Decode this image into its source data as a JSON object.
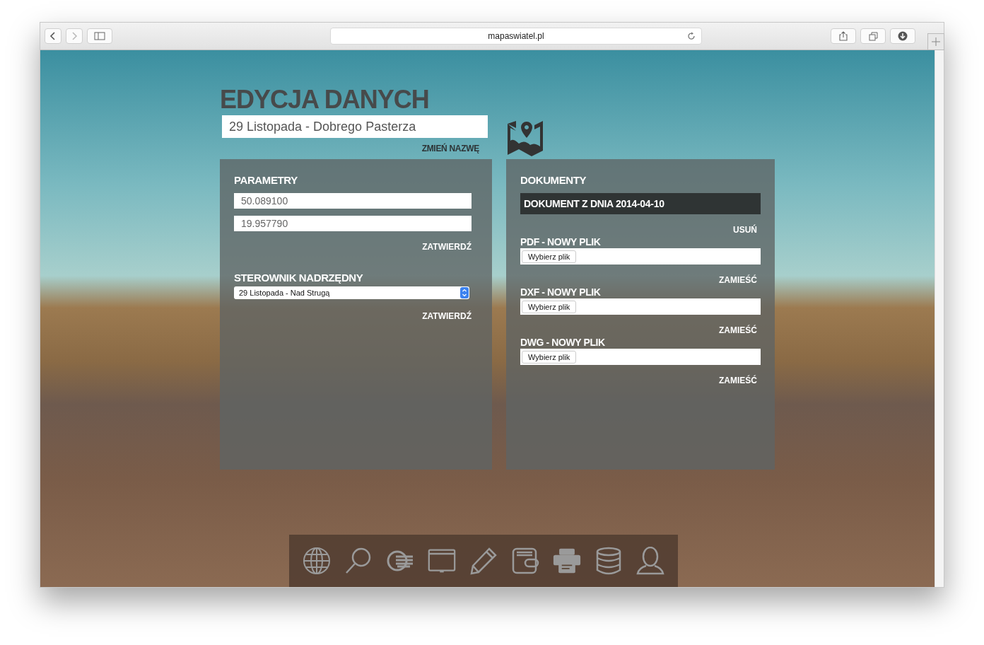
{
  "browser": {
    "url": "mapaswiatel.pl"
  },
  "page": {
    "title": "EDYCJA DANYCH",
    "name_value": "29 Listopada - Dobrego Pasterza",
    "rename_link": "ZMIEŃ NAZWĘ"
  },
  "parameters": {
    "title": "PARAMETRY",
    "fields": [
      "50.089100",
      "19.957790"
    ],
    "confirm": "ZATWIERDŹ",
    "parent_label": "STEROWNIK NADRZĘDNY",
    "parent_value": "29 Listopada - Nad Strugą",
    "parent_confirm": "ZATWIERDŹ"
  },
  "documents": {
    "title": "DOKUMENTY",
    "document": "DOKUMENT Z DNIA 2014-04-10",
    "delete": "USUŃ",
    "uploads": [
      {
        "label": "PDF - NOWY PLIK",
        "button": "Wybierz plik",
        "submit": "ZAMIEŚĆ"
      },
      {
        "label": "DXF - NOWY PLIK",
        "button": "Wybierz plik",
        "submit": "ZAMIEŚĆ"
      },
      {
        "label": "DWG - NOWY PLIK",
        "button": "Wybierz plik",
        "submit": "ZAMIEŚĆ"
      }
    ]
  }
}
